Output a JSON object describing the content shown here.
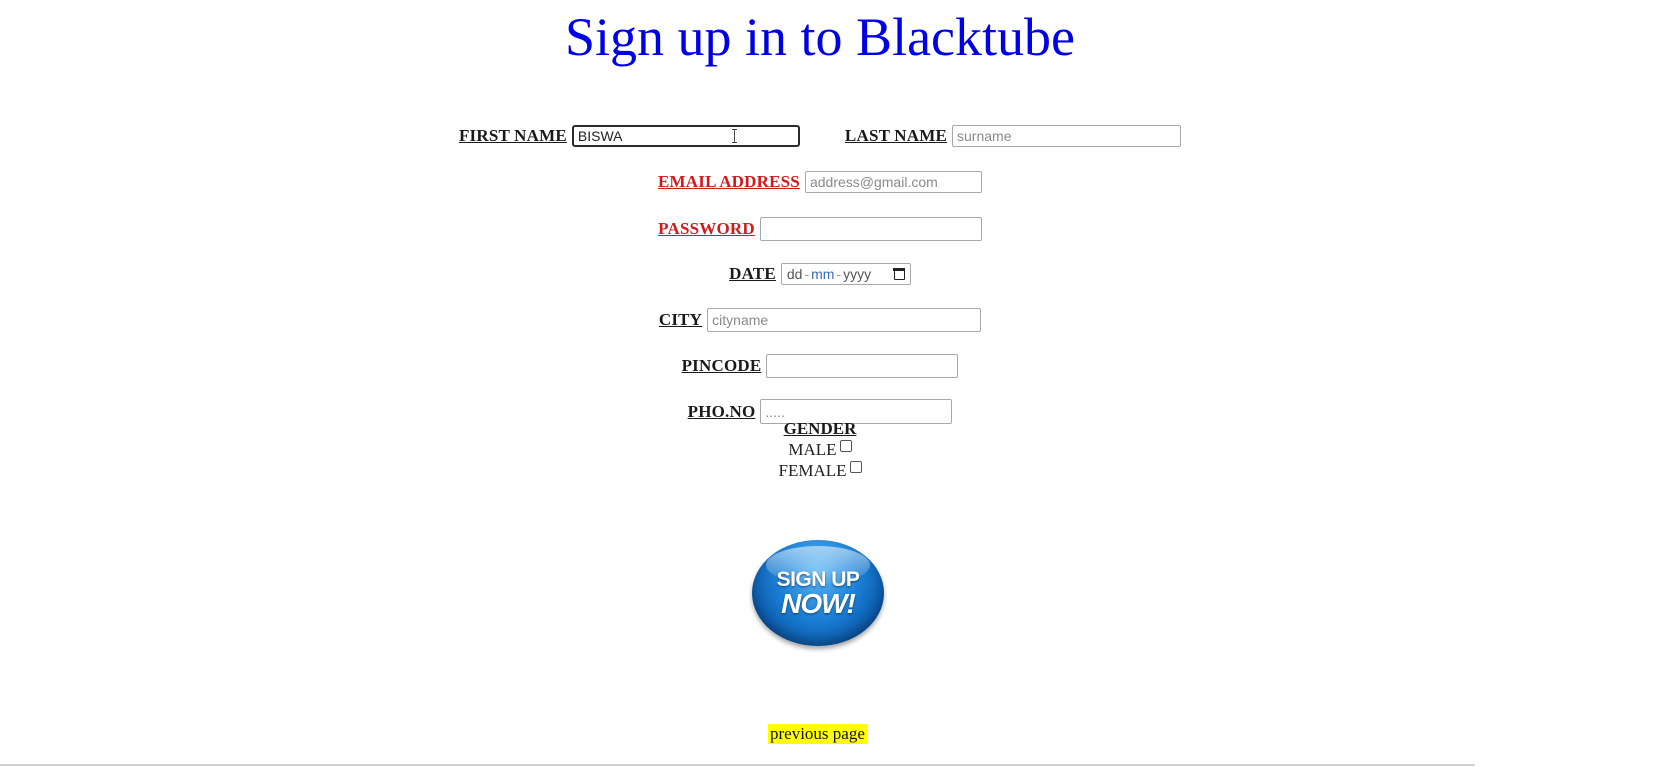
{
  "page": {
    "title": "Sign up in to Blacktube"
  },
  "form": {
    "first_name": {
      "label": "FIRST NAME",
      "value": "BISWA",
      "placeholder": ""
    },
    "last_name": {
      "label": "LAST NAME",
      "value": "",
      "placeholder": "surname"
    },
    "email": {
      "label": "EMAIL ADDRESS",
      "value": "",
      "placeholder": "address@gmail.com"
    },
    "password": {
      "label": "PASSWORD",
      "value": ""
    },
    "date": {
      "label": "DATE",
      "dd": "dd",
      "mm": "mm",
      "yyyy": "yyyy",
      "sep": "-"
    },
    "city": {
      "label": "CITY",
      "value": "",
      "placeholder": "cityname"
    },
    "pincode": {
      "label": "PINCODE",
      "value": ""
    },
    "phone": {
      "label": "PHO.NO",
      "value": "",
      "placeholder": "....."
    },
    "gender": {
      "label": "GENDER",
      "options": [
        {
          "label": "MALE",
          "checked": false
        },
        {
          "label": "FEMALE",
          "checked": false
        }
      ]
    }
  },
  "signup_button": {
    "line1": "SIGN UP",
    "line2": "NOW!"
  },
  "footer": {
    "previous_link": "previous page"
  }
}
